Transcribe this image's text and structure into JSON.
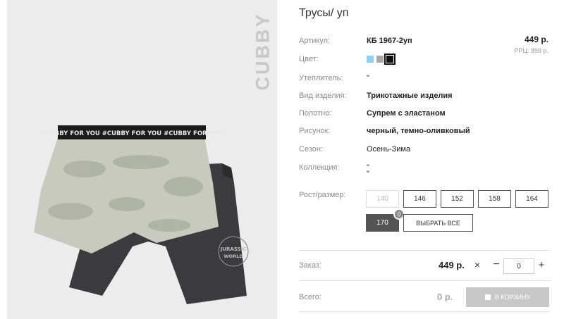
{
  "product": {
    "title": "Трусы/ уп",
    "brand": "CUBBY",
    "price": "449 р.",
    "rrp": "РРЦ: 899 р."
  },
  "attributes": {
    "article": {
      "label": "Артикул:",
      "value": "КБ 1967-2уп"
    },
    "color": {
      "label": "Цвет:"
    },
    "insulation": {
      "label": "Утеплитель:",
      "value": "\""
    },
    "type": {
      "label": "Вид изделия:",
      "value": "Трикотажные изделия"
    },
    "fabric": {
      "label": "Полотно:",
      "value": "Супрем с эластаном"
    },
    "pattern": {
      "label": "Рисунок:",
      "value": "черный, темно-оливковый"
    },
    "season": {
      "label": "Сезон:",
      "value": "Осень-Зима"
    },
    "collection": {
      "label": "Коллекция:",
      "value_line1": "\"",
      "value_line2": "\""
    }
  },
  "swatches": [
    {
      "color": "#8fd0f5",
      "selected": false
    },
    {
      "color": "#a9a9a9",
      "selected": false
    },
    {
      "color": "#111111",
      "selected": true
    }
  ],
  "sizes": {
    "label": "Рост/размер:",
    "options": [
      {
        "value": "140",
        "state": "disabled"
      },
      {
        "value": "146",
        "state": "normal"
      },
      {
        "value": "152",
        "state": "normal"
      },
      {
        "value": "158",
        "state": "normal"
      },
      {
        "value": "164",
        "state": "normal"
      },
      {
        "value": "170",
        "state": "active"
      }
    ],
    "select_all": "ВЫБРАТЬ ВСЕ",
    "badge": "0"
  },
  "order": {
    "label": "Заказ:",
    "price": "449 р.",
    "times": "×",
    "minus": "−",
    "quantity": "0",
    "plus": "+"
  },
  "total": {
    "label": "Всего:",
    "value": "0 р.",
    "cart_button": "В КОРЗИНУ"
  },
  "print": {
    "waistband_text": "#CUBBY FOR YOU #CUBBY FOR YOU #CUBBY FOR YOU",
    "logo_line1": "JURASSIC",
    "logo_line2": "WORLD"
  }
}
